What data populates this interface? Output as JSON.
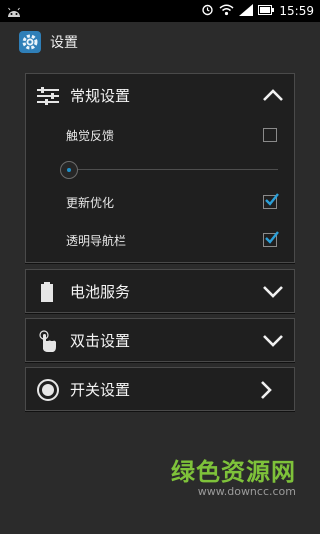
{
  "status_bar": {
    "time": "15:59"
  },
  "app_bar": {
    "title": "设置"
  },
  "panels": [
    {
      "label": "常规设置",
      "expanded": true,
      "icon": "sliders-icon",
      "options": [
        {
          "label": "触觉反馈",
          "checked": false
        },
        {
          "label": "更新优化",
          "checked": true
        },
        {
          "label": "透明导航栏",
          "checked": true
        }
      ],
      "slider_value": 0
    },
    {
      "label": "电池服务",
      "icon": "battery-icon",
      "chevron": "down"
    },
    {
      "label": "双击设置",
      "icon": "tap-hand-icon",
      "chevron": "down"
    },
    {
      "label": "开关设置",
      "icon": "toggle-circle-icon",
      "chevron": "right"
    }
  ],
  "watermark": {
    "main": "绿色资源网",
    "sub": "www.downcc.com"
  },
  "colors": {
    "accent": "#1e90c8",
    "watermark_green": "#7ec23a"
  }
}
